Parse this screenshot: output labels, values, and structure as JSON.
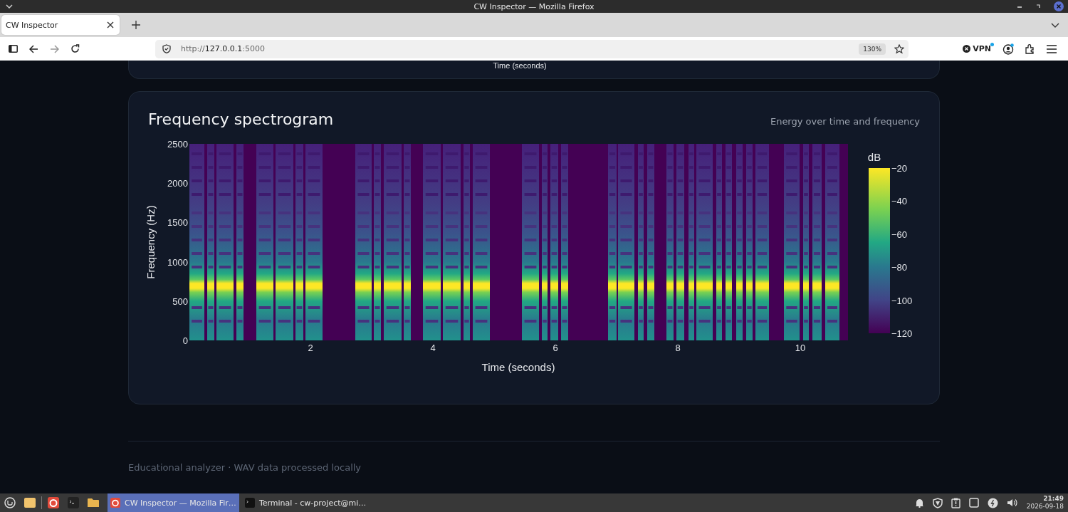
{
  "window": {
    "title": "CW Inspector — Mozilla Firefox"
  },
  "tabs": [
    {
      "label": "CW Inspector",
      "selected": true
    }
  ],
  "nav_buttons": [
    {
      "kind": "back",
      "disabled": false
    },
    {
      "kind": "forward",
      "disabled": true
    },
    {
      "kind": "reload",
      "disabled": false
    }
  ],
  "address_bar": {
    "scheme": "http://",
    "host": "127.0.0.1",
    "port": ":5000",
    "zoom": "130%"
  },
  "toolbar": {
    "vpn_label": "VPN"
  },
  "previous_card": {
    "axis_title": "Time (seconds)"
  },
  "spectrogram_card": {
    "title": "Frequency spectrogram",
    "subtitle": "Energy over time and frequency",
    "y_axis_title": "Frequency (Hz)",
    "y_ticks": [
      "2500",
      "2000",
      "1500",
      "1000",
      "500",
      "0"
    ],
    "x_axis_title": "Time (seconds)",
    "x_ticks": [
      "2",
      "4",
      "6",
      "8",
      "10"
    ],
    "colorbar": {
      "title": "dB",
      "ticks": [
        "−20",
        "−40",
        "−60",
        "−80",
        "−100",
        "−120"
      ]
    }
  },
  "footer": {
    "text": "Educational analyzer · WAV data processed locally"
  },
  "taskbar": {
    "windows": [
      {
        "label": "CW Inspector — Mozilla Fir…",
        "kind": "firefox",
        "selected": true
      },
      {
        "label": "Terminal - cw-project@mi…",
        "kind": "terminal",
        "selected": false
      }
    ],
    "clock": {
      "time": "21:49",
      "date": "2026-09-18"
    }
  }
}
